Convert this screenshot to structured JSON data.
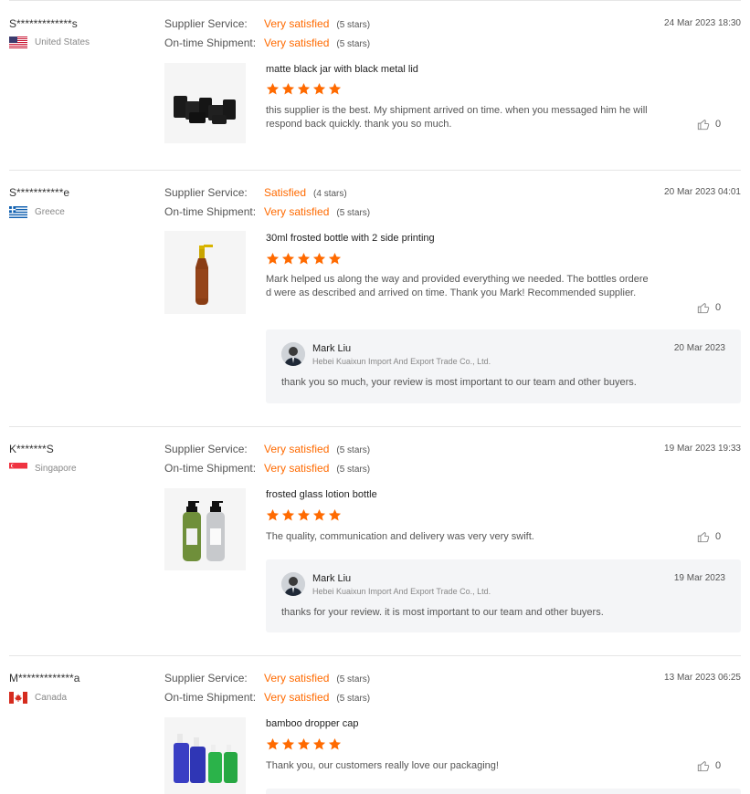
{
  "labels": {
    "supplier_service": "Supplier Service:",
    "ontime_shipment": "On-time Shipment:"
  },
  "colors": {
    "accent": "#ff6a00",
    "reply_bg": "#f4f5f7"
  },
  "reviews": [
    {
      "buyer": "S*************s",
      "country": "United States",
      "flag": "us-flag",
      "date": "24 Mar 2023 18:30",
      "supplier_service": {
        "value": "Very satisfied",
        "stars": "(5 stars)"
      },
      "ontime_shipment": {
        "value": "Very satisfied",
        "stars": "(5 stars)"
      },
      "product": "matte black jar with black metal lid",
      "rating": 5,
      "comment": "this supplier is the best. My shipment arrived on time. when you messaged him he will respond back quickly. thank you so much.",
      "likes": "0"
    },
    {
      "buyer": "S***********e",
      "country": "Greece",
      "flag": "greece-flag",
      "date": "20 Mar 2023 04:01",
      "supplier_service": {
        "value": "Satisfied",
        "stars": "(4 stars)"
      },
      "ontime_shipment": {
        "value": "Very satisfied",
        "stars": "(5 stars)"
      },
      "product": "30ml frosted bottle with 2 side printing",
      "rating": 5,
      "comment": "Mark helped us along the way and provided everything we needed. The bottles ordered were as described and arrived on time. Thank you Mark! Recommended supplier.",
      "likes": "0",
      "reply": {
        "name": "Mark Liu",
        "company": "Hebei Kuaixun Import And Export Trade Co., Ltd.",
        "date": "20 Mar 2023",
        "text": "thank you so much, your review is most important to our team and other buyers."
      }
    },
    {
      "buyer": "K*******S",
      "country": "Singapore",
      "flag": "singapore-flag",
      "date": "19 Mar 2023 19:33",
      "supplier_service": {
        "value": "Very satisfied",
        "stars": "(5 stars)"
      },
      "ontime_shipment": {
        "value": "Very satisfied",
        "stars": "(5 stars)"
      },
      "product": "frosted glass lotion bottle",
      "rating": 5,
      "comment": "The quality, communication and delivery was very very swift.",
      "likes": "0",
      "reply": {
        "name": "Mark Liu",
        "company": "Hebei Kuaixun Import And Export Trade Co., Ltd.",
        "date": "19 Mar 2023",
        "text": "thanks for your review. it is most important to our team and other buyers."
      }
    },
    {
      "buyer": "M*************a",
      "country": "Canada",
      "flag": "canada-flag",
      "date": "13 Mar 2023 06:25",
      "supplier_service": {
        "value": "Very satisfied",
        "stars": "(5 stars)"
      },
      "ontime_shipment": {
        "value": "Very satisfied",
        "stars": "(5 stars)"
      },
      "product": "bamboo dropper cap",
      "rating": 5,
      "comment": "Thank you, our customers really love our packaging!",
      "likes": "0"
    }
  ]
}
